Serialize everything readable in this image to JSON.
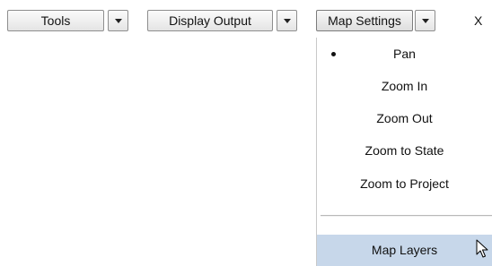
{
  "toolbar": {
    "tools_label": "Tools",
    "display_output_label": "Display Output",
    "map_settings_label": "Map Settings",
    "trailing_label": "X"
  },
  "map_settings_menu": {
    "selected_item": "Pan",
    "hovered_item": "Map Layers",
    "items": [
      {
        "label": "Pan"
      },
      {
        "label": "Zoom In"
      },
      {
        "label": "Zoom Out"
      },
      {
        "label": "Zoom to State"
      },
      {
        "label": "Zoom to Project"
      },
      {
        "label": "Map Layers"
      }
    ]
  },
  "colors": {
    "hover_highlight": "#c7d7ea",
    "button_border": "#8e8e8e"
  },
  "icons": {
    "dropdown_caret": "chevron-down-icon",
    "selected_marker": "bullet-icon",
    "pointer": "mouse-pointer-icon"
  }
}
